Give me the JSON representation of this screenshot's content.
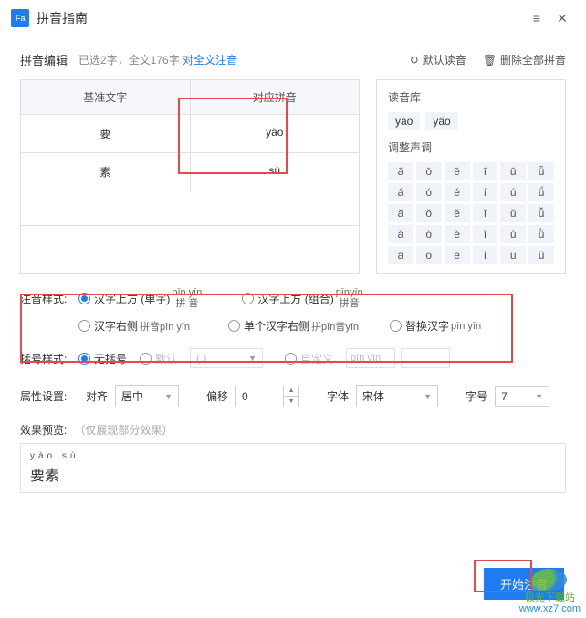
{
  "titlebar": {
    "title": "拼音指南"
  },
  "topbar": {
    "label": "拼音编辑",
    "status_prefix": "已选2字，全文176字 ",
    "link": "对全文注音",
    "default_read": "默认读音",
    "delete_all": "删除全部拼音"
  },
  "table": {
    "header_base": "基准文字",
    "header_pinyin": "对应拼音",
    "rows": [
      {
        "char": "要",
        "pinyin": "yào"
      },
      {
        "char": "素",
        "pinyin": "sù"
      }
    ]
  },
  "side": {
    "lib_label": "读音库",
    "tabs": [
      "yào",
      "yǎo"
    ],
    "tone_label": "调整声调",
    "tone_grid": [
      [
        "ā",
        "ō",
        "ē",
        "ī",
        "ū",
        "ǖ"
      ],
      [
        "á",
        "ó",
        "é",
        "í",
        "ú",
        "ǘ"
      ],
      [
        "ǎ",
        "ǒ",
        "ě",
        "ǐ",
        "ǔ",
        "ǚ"
      ],
      [
        "à",
        "ò",
        "è",
        "ì",
        "ù",
        "ǜ"
      ],
      [
        "a",
        "o",
        "e",
        "i",
        "u",
        "ü"
      ]
    ]
  },
  "style": {
    "label": "注音样式:",
    "opt_above_single": "汉字上方 (单字)",
    "opt_above_single_sample_top": "pīn yīn",
    "opt_above_single_sample_bot": "拼 音",
    "opt_above_combo": "汉字上方 (组合)",
    "opt_above_combo_sample_top": "pīnyīn",
    "opt_above_combo_sample_bot": "拼音",
    "opt_right": "汉字右侧",
    "opt_right_sample": "拼音pīn yīn",
    "opt_single_right": "单个汉字右侧",
    "opt_single_right_sample": "拼pīn音yīn",
    "opt_replace": "替换汉字",
    "opt_replace_sample": "pīn yīn"
  },
  "bracket": {
    "label": "括号样式:",
    "none": "无括号",
    "default": "默认",
    "default_ph": "( )",
    "custom": "自定义",
    "custom_ph": "pīn yīn"
  },
  "props": {
    "label": "属性设置:",
    "align_label": "对齐",
    "align_value": "居中",
    "offset_label": "偏移",
    "offset_value": "0",
    "font_label": "字体",
    "font_value": "宋体",
    "size_label": "字号",
    "size_value": "7"
  },
  "preview": {
    "label": "效果预览:",
    "note": "（仅展现部分效果）",
    "pinyin": "yào  sù",
    "hanzi": "要素"
  },
  "footer": {
    "start": "开始注音"
  },
  "watermark": {
    "name": "极光下载站",
    "url": "www.xz7.com"
  }
}
